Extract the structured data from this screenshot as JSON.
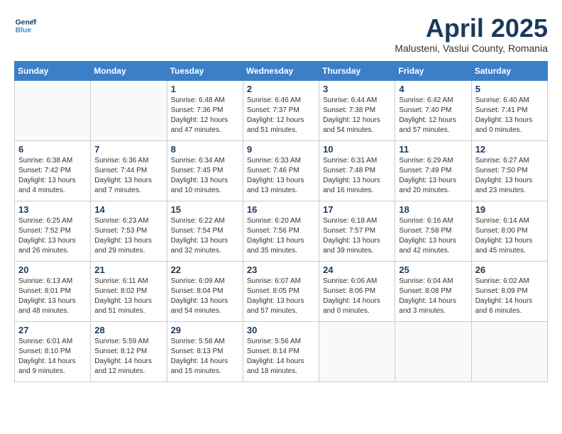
{
  "logo": {
    "line1": "General",
    "line2": "Blue"
  },
  "title": "April 2025",
  "subtitle": "Malusteni, Vaslui County, Romania",
  "days_of_week": [
    "Sunday",
    "Monday",
    "Tuesday",
    "Wednesday",
    "Thursday",
    "Friday",
    "Saturday"
  ],
  "weeks": [
    [
      {
        "day": "",
        "info": ""
      },
      {
        "day": "",
        "info": ""
      },
      {
        "day": "1",
        "info": "Sunrise: 6:48 AM\nSunset: 7:36 PM\nDaylight: 12 hours and 47 minutes."
      },
      {
        "day": "2",
        "info": "Sunrise: 6:46 AM\nSunset: 7:37 PM\nDaylight: 12 hours and 51 minutes."
      },
      {
        "day": "3",
        "info": "Sunrise: 6:44 AM\nSunset: 7:38 PM\nDaylight: 12 hours and 54 minutes."
      },
      {
        "day": "4",
        "info": "Sunrise: 6:42 AM\nSunset: 7:40 PM\nDaylight: 12 hours and 57 minutes."
      },
      {
        "day": "5",
        "info": "Sunrise: 6:40 AM\nSunset: 7:41 PM\nDaylight: 13 hours and 0 minutes."
      }
    ],
    [
      {
        "day": "6",
        "info": "Sunrise: 6:38 AM\nSunset: 7:42 PM\nDaylight: 13 hours and 4 minutes."
      },
      {
        "day": "7",
        "info": "Sunrise: 6:36 AM\nSunset: 7:44 PM\nDaylight: 13 hours and 7 minutes."
      },
      {
        "day": "8",
        "info": "Sunrise: 6:34 AM\nSunset: 7:45 PM\nDaylight: 13 hours and 10 minutes."
      },
      {
        "day": "9",
        "info": "Sunrise: 6:33 AM\nSunset: 7:46 PM\nDaylight: 13 hours and 13 minutes."
      },
      {
        "day": "10",
        "info": "Sunrise: 6:31 AM\nSunset: 7:48 PM\nDaylight: 13 hours and 16 minutes."
      },
      {
        "day": "11",
        "info": "Sunrise: 6:29 AM\nSunset: 7:49 PM\nDaylight: 13 hours and 20 minutes."
      },
      {
        "day": "12",
        "info": "Sunrise: 6:27 AM\nSunset: 7:50 PM\nDaylight: 13 hours and 23 minutes."
      }
    ],
    [
      {
        "day": "13",
        "info": "Sunrise: 6:25 AM\nSunset: 7:52 PM\nDaylight: 13 hours and 26 minutes."
      },
      {
        "day": "14",
        "info": "Sunrise: 6:23 AM\nSunset: 7:53 PM\nDaylight: 13 hours and 29 minutes."
      },
      {
        "day": "15",
        "info": "Sunrise: 6:22 AM\nSunset: 7:54 PM\nDaylight: 13 hours and 32 minutes."
      },
      {
        "day": "16",
        "info": "Sunrise: 6:20 AM\nSunset: 7:56 PM\nDaylight: 13 hours and 35 minutes."
      },
      {
        "day": "17",
        "info": "Sunrise: 6:18 AM\nSunset: 7:57 PM\nDaylight: 13 hours and 39 minutes."
      },
      {
        "day": "18",
        "info": "Sunrise: 6:16 AM\nSunset: 7:58 PM\nDaylight: 13 hours and 42 minutes."
      },
      {
        "day": "19",
        "info": "Sunrise: 6:14 AM\nSunset: 8:00 PM\nDaylight: 13 hours and 45 minutes."
      }
    ],
    [
      {
        "day": "20",
        "info": "Sunrise: 6:13 AM\nSunset: 8:01 PM\nDaylight: 13 hours and 48 minutes."
      },
      {
        "day": "21",
        "info": "Sunrise: 6:11 AM\nSunset: 8:02 PM\nDaylight: 13 hours and 51 minutes."
      },
      {
        "day": "22",
        "info": "Sunrise: 6:09 AM\nSunset: 8:04 PM\nDaylight: 13 hours and 54 minutes."
      },
      {
        "day": "23",
        "info": "Sunrise: 6:07 AM\nSunset: 8:05 PM\nDaylight: 13 hours and 57 minutes."
      },
      {
        "day": "24",
        "info": "Sunrise: 6:06 AM\nSunset: 8:06 PM\nDaylight: 14 hours and 0 minutes."
      },
      {
        "day": "25",
        "info": "Sunrise: 6:04 AM\nSunset: 8:08 PM\nDaylight: 14 hours and 3 minutes."
      },
      {
        "day": "26",
        "info": "Sunrise: 6:02 AM\nSunset: 8:09 PM\nDaylight: 14 hours and 6 minutes."
      }
    ],
    [
      {
        "day": "27",
        "info": "Sunrise: 6:01 AM\nSunset: 8:10 PM\nDaylight: 14 hours and 9 minutes."
      },
      {
        "day": "28",
        "info": "Sunrise: 5:59 AM\nSunset: 8:12 PM\nDaylight: 14 hours and 12 minutes."
      },
      {
        "day": "29",
        "info": "Sunrise: 5:58 AM\nSunset: 8:13 PM\nDaylight: 14 hours and 15 minutes."
      },
      {
        "day": "30",
        "info": "Sunrise: 5:56 AM\nSunset: 8:14 PM\nDaylight: 14 hours and 18 minutes."
      },
      {
        "day": "",
        "info": ""
      },
      {
        "day": "",
        "info": ""
      },
      {
        "day": "",
        "info": ""
      }
    ]
  ]
}
